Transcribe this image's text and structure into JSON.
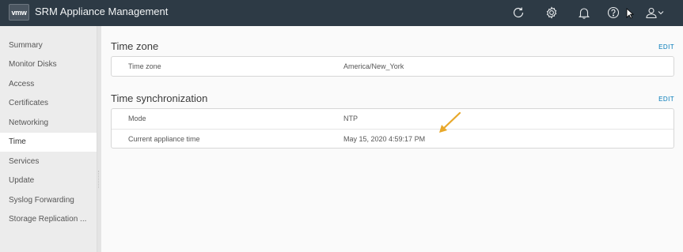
{
  "header": {
    "logo_text": "vmw",
    "title": "SRM Appliance Management",
    "icons": [
      "refresh-icon",
      "gear-icon",
      "bell-icon",
      "help-icon",
      "user-icon",
      "chevron-down-icon"
    ]
  },
  "sidebar": {
    "items": [
      {
        "label": "Summary"
      },
      {
        "label": "Monitor Disks"
      },
      {
        "label": "Access"
      },
      {
        "label": "Certificates"
      },
      {
        "label": "Networking"
      },
      {
        "label": "Time",
        "active": true
      },
      {
        "label": "Services"
      },
      {
        "label": "Update"
      },
      {
        "label": "Syslog Forwarding"
      },
      {
        "label": "Storage Replication ..."
      }
    ]
  },
  "main": {
    "time_zone": {
      "title": "Time zone",
      "edit_label": "EDIT",
      "rows": [
        {
          "key": "Time zone",
          "value": "America/New_York"
        }
      ]
    },
    "time_sync": {
      "title": "Time synchronization",
      "edit_label": "EDIT",
      "rows": [
        {
          "key": "Mode",
          "value": "NTP"
        },
        {
          "key": "Current appliance time",
          "value": "May 15, 2020 4:59:17 PM"
        }
      ]
    }
  },
  "colors": {
    "header_bg": "#2d3a45",
    "accent": "#0079b8",
    "annotation_arrow": "#e8a82a"
  }
}
